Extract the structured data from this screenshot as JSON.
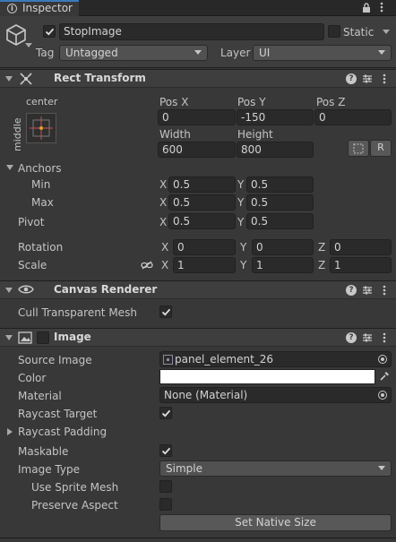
{
  "tab": {
    "title": "Inspector"
  },
  "gameobject": {
    "name": "StopImage",
    "static_label": "Static",
    "tag_label": "Tag",
    "tag_value": "Untagged",
    "layer_label": "Layer",
    "layer_value": "UI"
  },
  "rect_transform": {
    "title": "Rect Transform",
    "anchor_preset_top": "center",
    "anchor_preset_side": "middle",
    "pos_x_label": "Pos X",
    "pos_y_label": "Pos Y",
    "pos_z_label": "Pos Z",
    "pos_x": "0",
    "pos_y": "-150",
    "pos_z": "0",
    "width_label": "Width",
    "height_label": "Height",
    "width": "600",
    "height": "800",
    "raw_button": "R",
    "anchors_label": "Anchors",
    "min_label": "Min",
    "max_label": "Max",
    "pivot_label": "Pivot",
    "min_x": "0.5",
    "min_y": "0.5",
    "max_x": "0.5",
    "max_y": "0.5",
    "pivot_x": "0.5",
    "pivot_y": "0.5",
    "rotation_label": "Rotation",
    "scale_label": "Scale",
    "rot_x": "0",
    "rot_y": "0",
    "rot_z": "0",
    "scale_x": "1",
    "scale_y": "1",
    "scale_z": "1",
    "axis_x": "X",
    "axis_y": "Y",
    "axis_z": "Z"
  },
  "canvas_renderer": {
    "title": "Canvas Renderer",
    "cull_label": "Cull Transparent Mesh"
  },
  "image": {
    "title": "Image",
    "source_label": "Source Image",
    "source_value": "panel_element_26",
    "color_label": "Color",
    "color_value": "#ffffff",
    "material_label": "Material",
    "material_value": "None (Material)",
    "raycast_target_label": "Raycast Target",
    "raycast_padding_label": "Raycast Padding",
    "maskable_label": "Maskable",
    "image_type_label": "Image Type",
    "image_type_value": "Simple",
    "use_sprite_mesh_label": "Use Sprite Mesh",
    "preserve_aspect_label": "Preserve Aspect",
    "native_size_button": "Set Native Size"
  },
  "colors": {
    "accent": "#3a79bb",
    "bg": "#383838",
    "field": "#2a2a2a"
  }
}
